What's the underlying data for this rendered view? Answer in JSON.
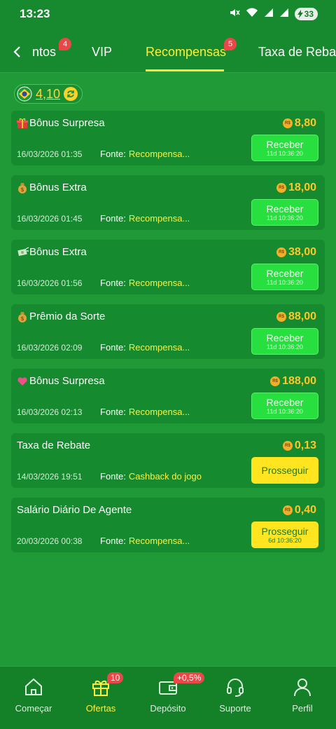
{
  "status_bar": {
    "time": "13:23",
    "battery": "33",
    "icons": [
      "mute-icon",
      "wifi-icon",
      "signal-icon",
      "signal-icon",
      "battery-charging-icon"
    ]
  },
  "tabs": {
    "items": [
      {
        "label": "ntos",
        "badge": "4"
      },
      {
        "label": "VIP",
        "badge": null
      },
      {
        "label": "Recompensas",
        "badge": "5",
        "active": true
      },
      {
        "label": "Taxa de Rebat",
        "badge": null
      }
    ]
  },
  "balance": {
    "value": "4,10"
  },
  "labels": {
    "source": "Fonte:"
  },
  "rewards": [
    {
      "title": "Bônus Surpresa",
      "icon": "gift-icon",
      "amount": "8,80",
      "date": "16/03/2026 01:35",
      "source": "Recompensa...",
      "button": "Receber",
      "timer": "11d 10:36:20",
      "type": "receive"
    },
    {
      "title": "Bônus Extra",
      "icon": "money-bag-icon",
      "amount": "18,00",
      "date": "16/03/2026 01:45",
      "source": "Recompensa...",
      "button": "Receber",
      "timer": "11d 10:36:20",
      "type": "receive"
    },
    {
      "title": "Bônus Extra",
      "icon": "flying-money-icon",
      "amount": "38,00",
      "date": "16/03/2026 01:56",
      "source": "Recompensa...",
      "button": "Receber",
      "timer": "11d 10:36:20",
      "type": "receive"
    },
    {
      "title": "Prêmio da Sorte",
      "icon": "money-bag-icon",
      "amount": "88,00",
      "date": "16/03/2026 02:09",
      "source": "Recompensa...",
      "button": "Receber",
      "timer": "11d 10:36:20",
      "type": "receive"
    },
    {
      "title": "Bônus Surpresa",
      "icon": "heart-icon",
      "amount": "188,00",
      "date": "16/03/2026 02:13",
      "source": "Recompensa...",
      "button": "Receber",
      "timer": "11d 10:36:20",
      "type": "receive"
    },
    {
      "title": "Taxa de Rebate",
      "icon": null,
      "amount": "0,13",
      "date": "14/03/2026 19:51",
      "source": "Cashback do jogo",
      "button": "Prosseguir",
      "timer": "",
      "type": "continue"
    },
    {
      "title": "Salário Diário De Agente",
      "icon": null,
      "amount": "0,40",
      "date": "20/03/2026 00:38",
      "source": "Recompensa...",
      "button": "Prosseguir",
      "timer": "6d 10:36:20",
      "type": "continue"
    }
  ],
  "coin_label": "R$",
  "bottom_nav": [
    {
      "label": "Começar",
      "icon": "home-icon",
      "badge": null
    },
    {
      "label": "Ofertas",
      "icon": "gift-icon",
      "badge": "10",
      "active": true
    },
    {
      "label": "Depósito",
      "icon": "wallet-icon",
      "badge": "+0,5%"
    },
    {
      "label": "Suporte",
      "icon": "headset-icon",
      "badge": null
    },
    {
      "label": "Perfil",
      "icon": "user-icon",
      "badge": null
    }
  ],
  "colors": {
    "background": "#1f9a37",
    "header": "#17892e",
    "card": "#168a2e",
    "accent_yellow": "#ffef3a",
    "amount_orange": "#ffc52a",
    "receive_button": "#27e03f",
    "continue_button": "#ffe51f"
  }
}
